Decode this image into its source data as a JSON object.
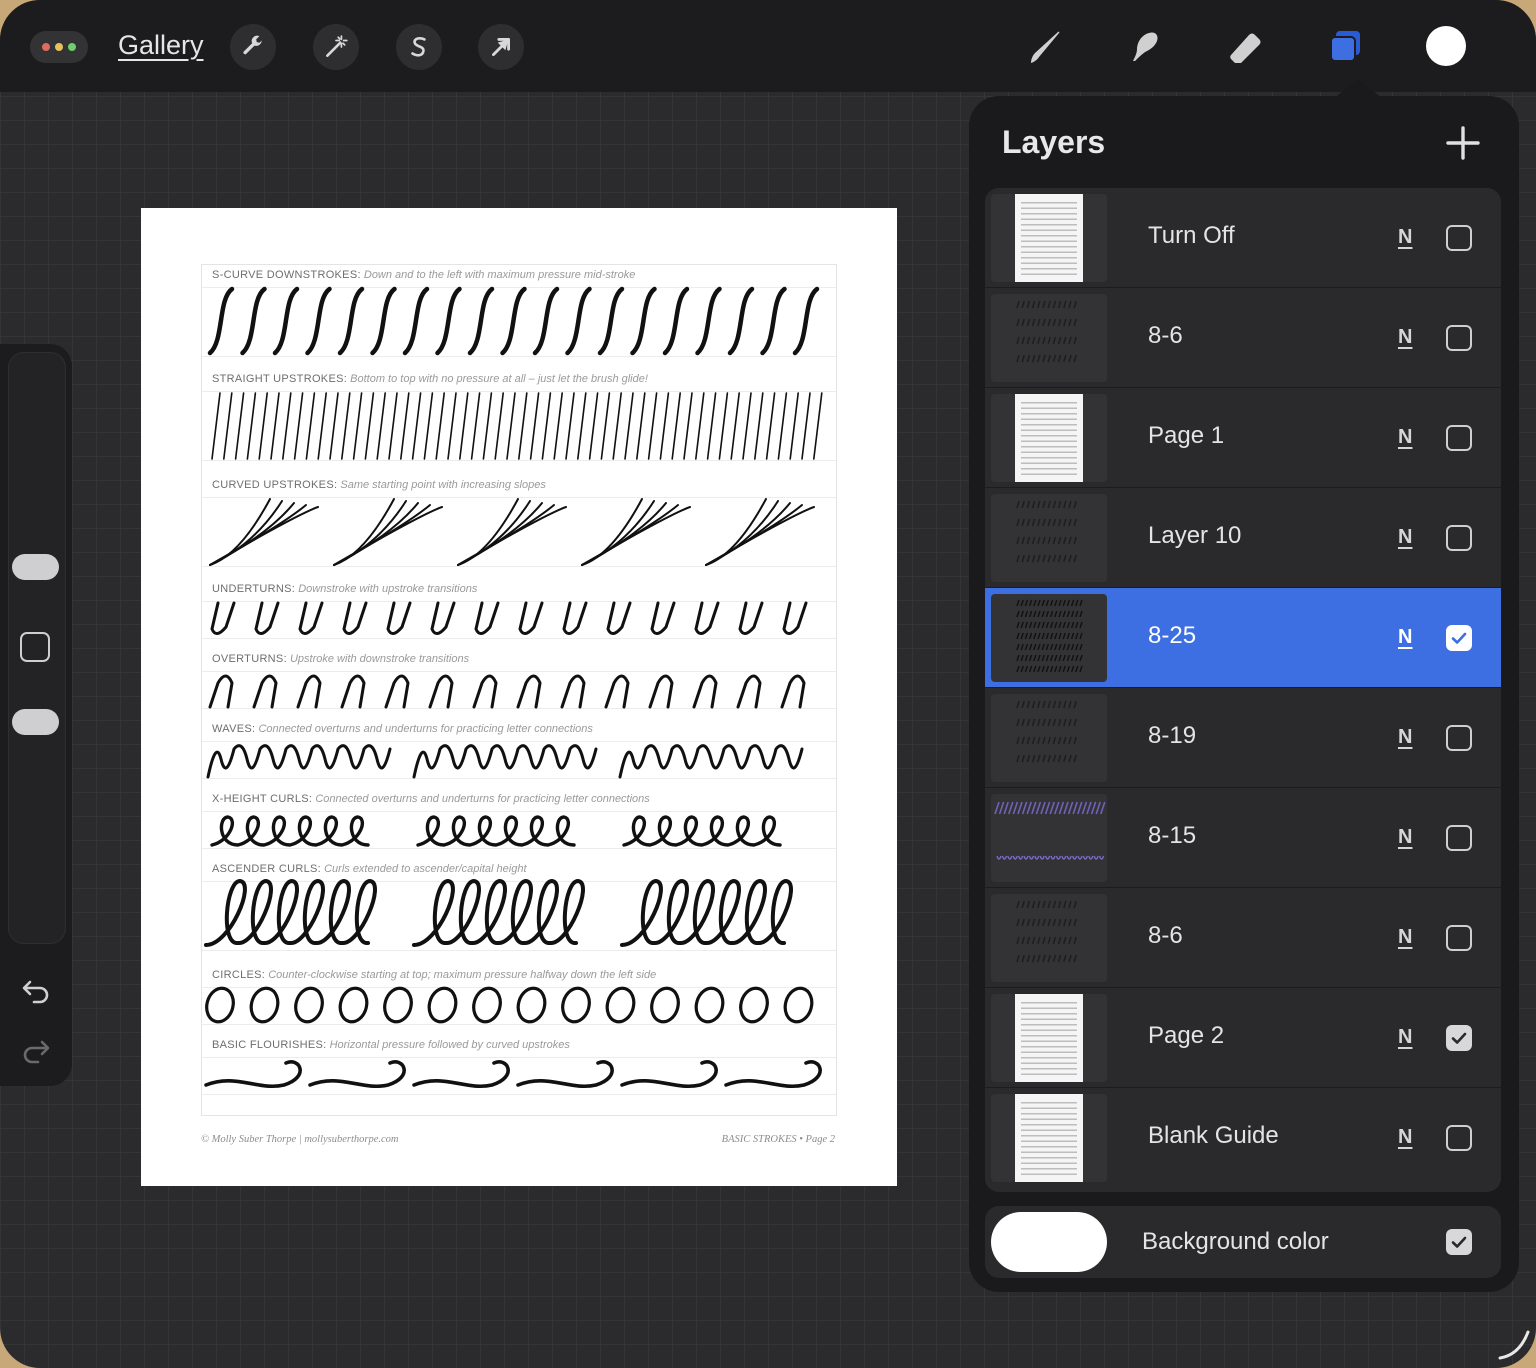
{
  "toolbar": {
    "gallery_label": "Gallery",
    "menu_dot_colors": [
      "#e06c5f",
      "#e6c25c",
      "#6fcf6a"
    ],
    "left_tools": [
      "wrench-icon",
      "magic-wand-icon",
      "selection-s-icon",
      "transform-arrow-icon"
    ],
    "right_tools": [
      "brush-icon",
      "smudge-icon",
      "eraser-icon",
      "layers-icon"
    ],
    "active_tool_color": "#3e6fe2",
    "current_color": "#ffffff"
  },
  "sidebar": {
    "icons": [
      "undo-icon",
      "redo-icon"
    ]
  },
  "document": {
    "rows": [
      {
        "title": "S-CURVE DOWNSTROKES:",
        "desc": "Down and to the left with maximum pressure mid-stroke"
      },
      {
        "title": "STRAIGHT UPSTROKES:",
        "desc": "Bottom to top with no pressure at all – just let the brush glide!"
      },
      {
        "title": "CURVED UPSTROKES:",
        "desc": "Same starting point with increasing slopes"
      },
      {
        "title": "UNDERTURNS:",
        "desc": "Downstroke with upstroke transitions"
      },
      {
        "title": "OVERTURNS:",
        "desc": "Upstroke with downstroke transitions"
      },
      {
        "title": "WAVES:",
        "desc": "Connected overturns and underturns for practicing letter connections"
      },
      {
        "title": "X-HEIGHT CURLS:",
        "desc": "Connected overturns and underturns for practicing letter connections"
      },
      {
        "title": "ASCENDER CURLS:",
        "desc": "Curls extended to ascender/capital height"
      },
      {
        "title": "CIRCLES:",
        "desc": "Counter-clockwise starting at top; maximum pressure halfway down the left side"
      },
      {
        "title": "BASIC FLOURISHES:",
        "desc": "Horizontal pressure followed by curved upstrokes"
      }
    ],
    "footer_left": "© Molly Suber Thorpe  |  mollysuberthorpe.com",
    "footer_right": "BASIC STROKES  •  Page 2"
  },
  "layers_panel": {
    "title": "Layers",
    "add_icon": "plus-icon",
    "layers": [
      {
        "name": "Turn Off",
        "blend": "N",
        "visible": false,
        "active": false,
        "thumb": "page"
      },
      {
        "name": "8-6",
        "blend": "N",
        "visible": false,
        "active": false,
        "thumb": "dark"
      },
      {
        "name": "Page 1",
        "blend": "N",
        "visible": false,
        "active": false,
        "thumb": "page"
      },
      {
        "name": "Layer 10",
        "blend": "N",
        "visible": false,
        "active": false,
        "thumb": "dark"
      },
      {
        "name": "8-25",
        "blend": "N",
        "visible": true,
        "active": true,
        "thumb": "dark"
      },
      {
        "name": "8-19",
        "blend": "N",
        "visible": false,
        "active": false,
        "thumb": "dark"
      },
      {
        "name": "8-15",
        "blend": "N",
        "visible": false,
        "active": false,
        "thumb": "purple"
      },
      {
        "name": "8-6",
        "blend": "N",
        "visible": false,
        "active": false,
        "thumb": "dark"
      },
      {
        "name": "Page 2",
        "blend": "N",
        "visible": true,
        "active": false,
        "thumb": "page"
      },
      {
        "name": "Blank Guide",
        "blend": "N",
        "visible": false,
        "active": false,
        "thumb": "page"
      }
    ],
    "background": {
      "label": "Background color",
      "visible": true,
      "color": "#ffffff"
    }
  }
}
